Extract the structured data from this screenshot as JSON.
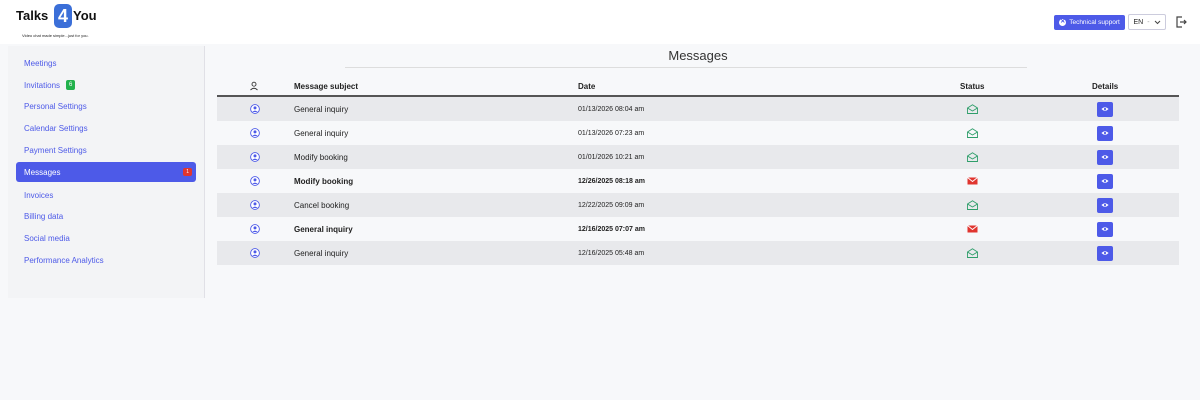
{
  "logo": {
    "text_left": "Talks",
    "number": "4",
    "text_right": "You",
    "tagline": "Video chat made simple...just for you."
  },
  "header": {
    "support_label": "Technical support",
    "language": "EN",
    "logout_icon": "logout-icon"
  },
  "colors": {
    "accent": "#4d5ae8",
    "read_status": "#2e9e6a",
    "unread_status": "#e0352f",
    "badge_green": "#22b14c"
  },
  "sidebar": {
    "items": [
      {
        "label": "Meetings"
      },
      {
        "label": "Invitations",
        "badge": "6"
      },
      {
        "label": "Personal Settings"
      },
      {
        "label": "Calendar Settings"
      },
      {
        "label": "Payment Settings"
      },
      {
        "label": "Messages",
        "badge": "1",
        "active": true
      },
      {
        "label": "Invoices"
      },
      {
        "label": "Billing data"
      },
      {
        "label": "Social media"
      },
      {
        "label": "Performance Analytics"
      }
    ]
  },
  "main": {
    "title": "Messages",
    "columns": {
      "user_icon": "user-icon",
      "subject": "Message subject",
      "date": "Date",
      "status": "Status",
      "details": "Details"
    },
    "rows": [
      {
        "subject": "General inquiry",
        "date": "01/13/2026 08:04 am",
        "status": "read"
      },
      {
        "subject": "General inquiry",
        "date": "01/13/2026 07:23 am",
        "status": "read"
      },
      {
        "subject": "Modify booking",
        "date": "01/01/2026 10:21 am",
        "status": "read"
      },
      {
        "subject": "Modify booking",
        "date": "12/26/2025 08:18 am",
        "status": "unread"
      },
      {
        "subject": "Cancel booking",
        "date": "12/22/2025 09:09 am",
        "status": "read"
      },
      {
        "subject": "General inquiry",
        "date": "12/16/2025 07:07 am",
        "status": "unread"
      },
      {
        "subject": "General inquiry",
        "date": "12/16/2025 05:48 am",
        "status": "read"
      }
    ]
  }
}
